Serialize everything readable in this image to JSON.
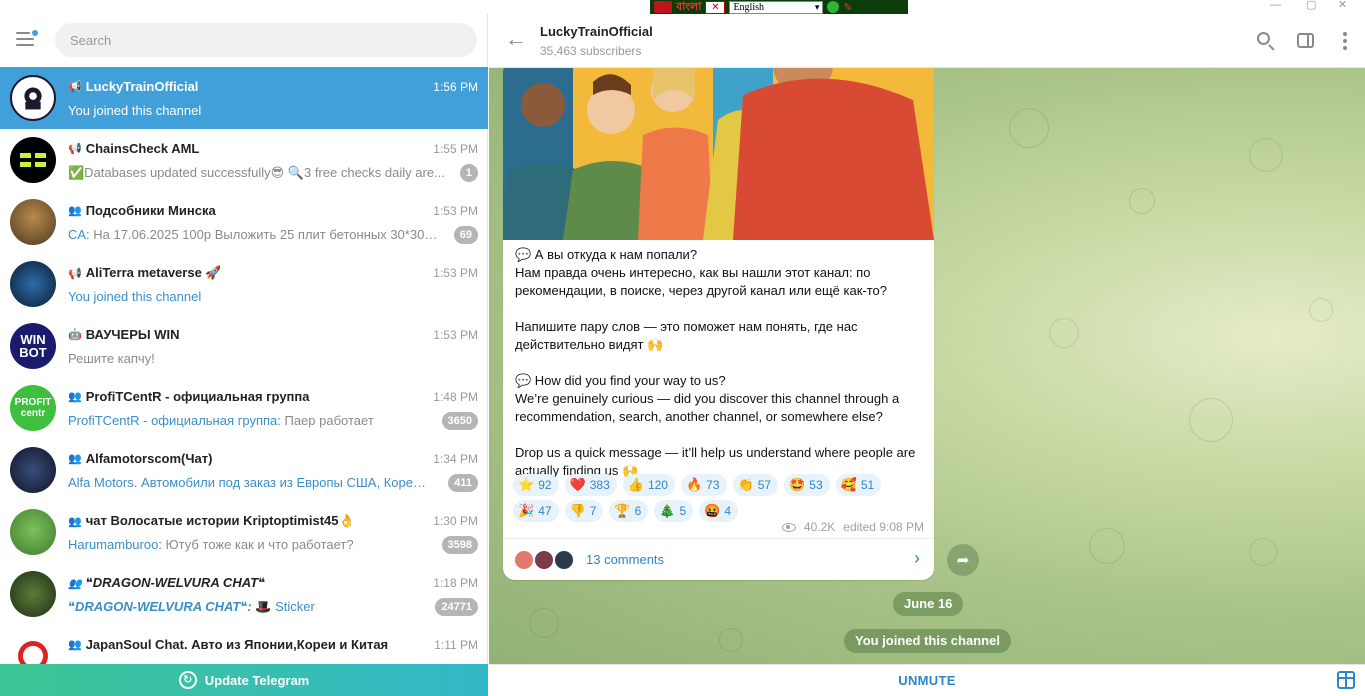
{
  "topbar": {
    "lang_script": "বাংলা",
    "lang_select": "English"
  },
  "search": {
    "placeholder": "Search"
  },
  "chats": [
    {
      "title": "LuckyTrainOfficial",
      "kind": "channel",
      "time": "1:56 PM",
      "message": "You joined this channel",
      "sender": "",
      "badge": ""
    },
    {
      "title": "ChainsCheck AML",
      "kind": "channel",
      "time": "1:55 PM",
      "message": "✅Databases updated successfully😎 🔍3 free checks daily are...",
      "sender": "",
      "badge": "1"
    },
    {
      "title": "Подсобники Минска",
      "kind": "group",
      "time": "1:53 PM",
      "sender": "CA:",
      "message": " На 17.06.2025  100р  Выложить 25 плит бетонных 30*30см...",
      "badge": "69"
    },
    {
      "title": "AliTerra metaverse 🚀",
      "kind": "channel",
      "time": "1:53 PM",
      "message": "You joined this channel",
      "sender": "",
      "badge": ""
    },
    {
      "title": "ВАУЧЕРЫ WIN",
      "kind": "bot",
      "time": "1:53 PM",
      "message": "Решите капчу!",
      "sender": "",
      "badge": ""
    },
    {
      "title": "ProfiTCentR - официальная группа",
      "kind": "group",
      "time": "1:48 PM",
      "sender": "ProfiTCentR - официальная группа:",
      "message": " Паер работает",
      "badge": "3650"
    },
    {
      "title": "Alfamotorscom(Чат)",
      "kind": "group",
      "time": "1:34 PM",
      "sender": "Alfa Motors. Автомобили под заказ из Европы США, Кореи.:",
      "message": " ...",
      "badge": "411"
    },
    {
      "title": "чат Волосатые истории Kriptoptimist45👌",
      "kind": "group",
      "time": "1:30 PM",
      "sender": "Harumamburoo:",
      "message": " Ютуб тоже как и что работает?",
      "badge": "3598"
    },
    {
      "title": "❝DRAGON-WELVURA CHAT❝",
      "kind": "group",
      "time": "1:18 PM",
      "sender": "❝DRAGON-WELVURA CHAT❝:",
      "message": " 🎩 Sticker",
      "badge": "24771"
    },
    {
      "title": "JapanSoul Chat. Авто из Японии,Кореи и Китая",
      "kind": "group",
      "time": "1:11 PM",
      "sender": "",
      "message": "",
      "badge": ""
    }
  ],
  "update": {
    "label": "Update Telegram"
  },
  "channel": {
    "title": "LuckyTrainOfficial",
    "subscribers": "35,463 subscribers"
  },
  "post": {
    "text": "💬 А вы откуда к нам попали?\nНам правда очень интересно, как вы нашли этот канал: по рекомендации, в поиске, через другой канал или ещё как-то?\n\nНапишите пару слов — это поможет нам понять, где нас действительно видят 🙌\n\n💬 How did you find your way to us?\nWe’re genuinely curious — did you discover this channel through a recommendation, search, another channel, or somewhere else?\n\nDrop us a quick message — it’ll help us understand where people are actually finding us 🙌",
    "reactions_row1": [
      {
        "emoji": "⭐",
        "count": "92"
      },
      {
        "emoji": "❤️",
        "count": "383"
      },
      {
        "emoji": "👍",
        "count": "120"
      },
      {
        "emoji": "🔥",
        "count": "73"
      },
      {
        "emoji": "👏",
        "count": "57"
      },
      {
        "emoji": "🤩",
        "count": "53"
      },
      {
        "emoji": "🥰",
        "count": "51"
      }
    ],
    "reactions_row2": [
      {
        "emoji": "🎉",
        "count": "47"
      },
      {
        "emoji": "👎",
        "count": "7"
      },
      {
        "emoji": "🏆",
        "count": "6"
      },
      {
        "emoji": "🎄",
        "count": "5"
      },
      {
        "emoji": "🤬",
        "count": "4"
      }
    ],
    "views": "40.2K",
    "edited": "edited 9:08 PM",
    "comments": "13 comments"
  },
  "service": {
    "date": "June 16",
    "joined": "You joined this channel"
  },
  "bottom": {
    "unmute": "UNMUTE"
  },
  "colors": {
    "accent": "#419fd9",
    "link": "#2e86c8",
    "badge": "#b5b5b5",
    "update_gradient_start": "#3cc694",
    "update_gradient_end": "#33b8c9"
  }
}
